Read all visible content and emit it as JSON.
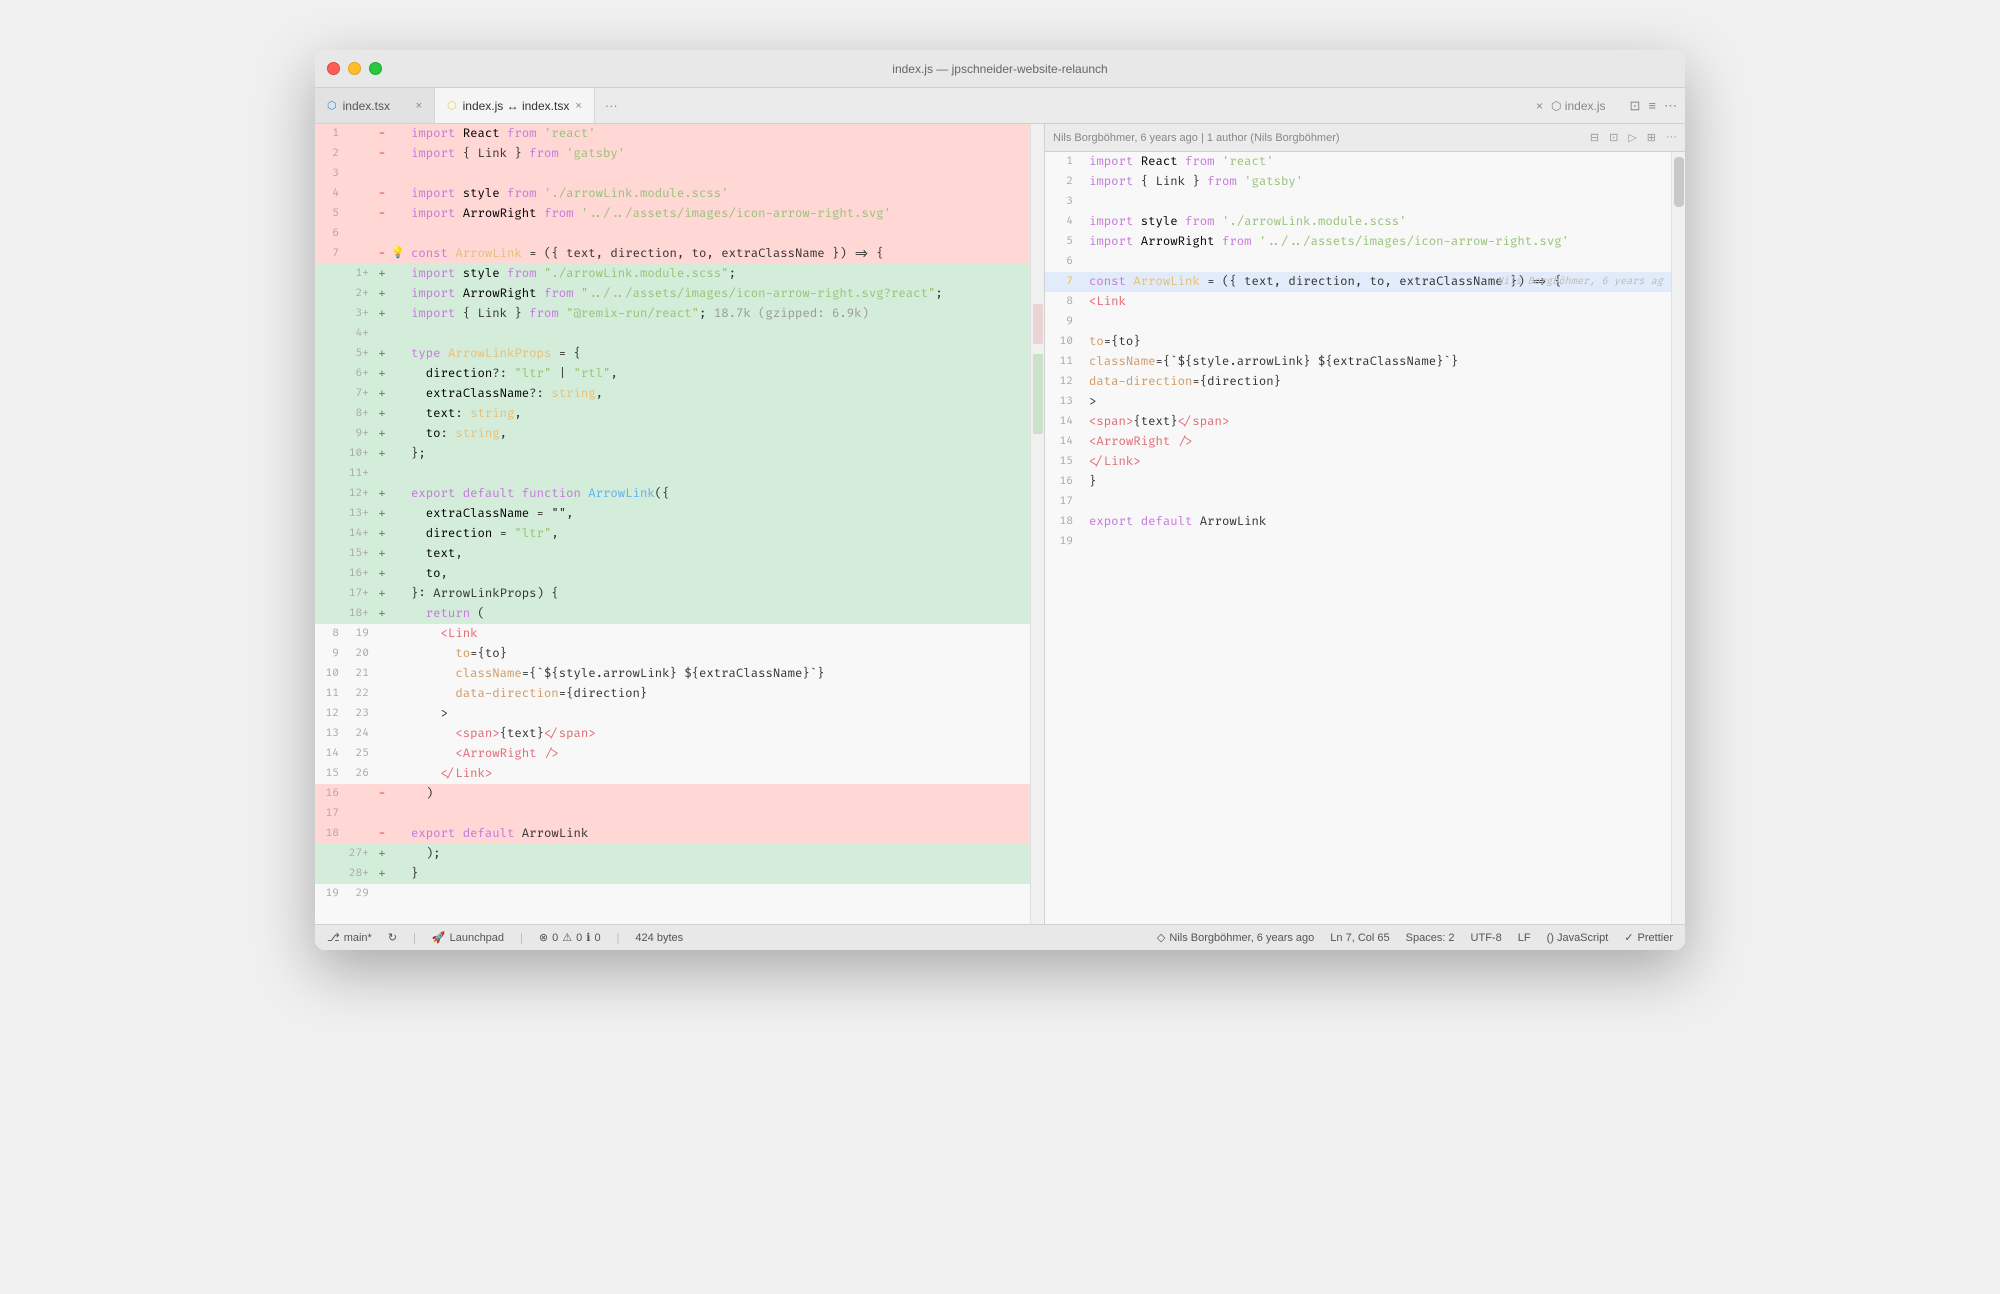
{
  "window": {
    "title": "index.js — jpschneider-website-relaunch"
  },
  "tabs": [
    {
      "id": "tab1",
      "label": "index.tsx",
      "icon": "tsx",
      "active": false,
      "closeable": true,
      "modified": false
    },
    {
      "id": "tab2",
      "label": "index.js ↔ index.tsx",
      "icon": "js",
      "active": true,
      "closeable": true,
      "modified": false
    }
  ],
  "right_tab": {
    "label": "index.js",
    "icon": "js"
  },
  "blame_info": "Nils Borgböhmer, 6 years ago | 1 author (Nils Borgböhmer)",
  "right_blame_inline": "Nils Borgböhmer, 6 years ag",
  "statusbar": {
    "branch": "main*",
    "sync": "sync",
    "launchpad": "Launchpad",
    "errors": "0",
    "warnings": "0",
    "info": "0",
    "size": "424 bytes",
    "author": "Nils Borgböhmer, 6 years ago",
    "position": "Ln 7, Col 65",
    "spaces": "Spaces: 2",
    "encoding": "UTF-8",
    "eol": "LF",
    "language": "() JavaScript",
    "formatter": "✓ Prettier"
  }
}
